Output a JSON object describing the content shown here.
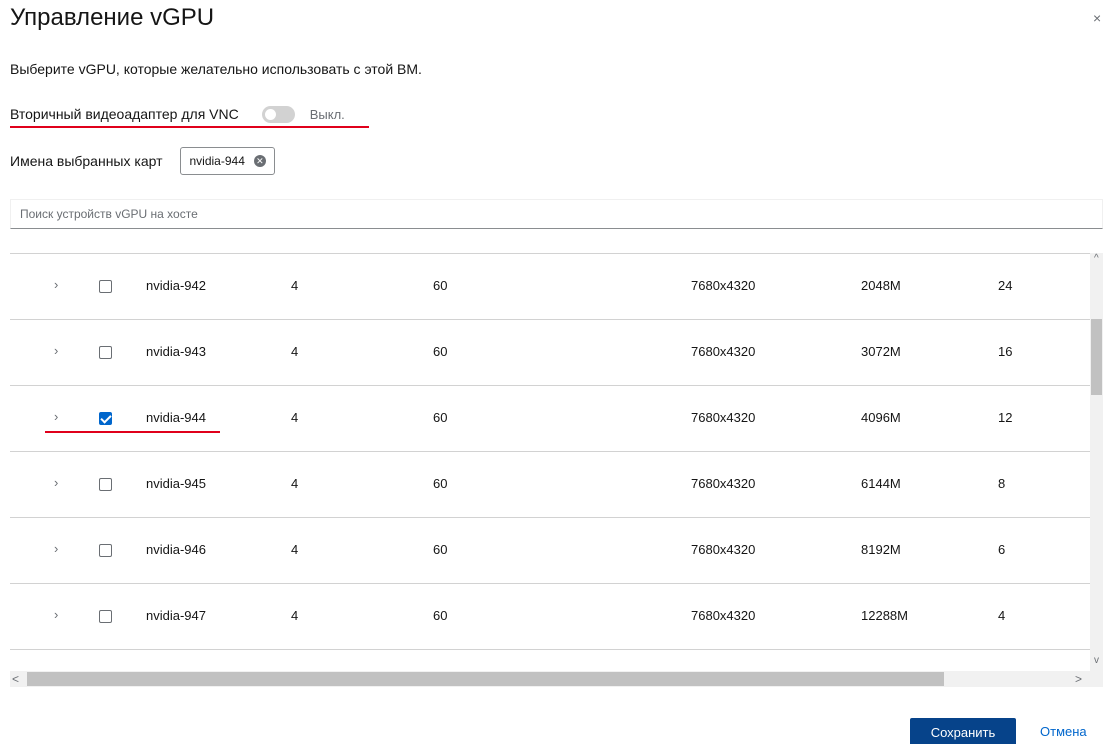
{
  "dialog": {
    "title": "Управление vGPU",
    "close_symbol": "×",
    "description": "Выберите vGPU, которые желательно использовать с этой ВМ."
  },
  "vnc": {
    "label": "Вторичный видеоадаптер для VNC",
    "toggle_state": "Выкл.",
    "enabled": false
  },
  "selected_cards": {
    "label": "Имена выбранных карт",
    "chips": [
      "nvidia-944"
    ],
    "remove_icon": "x-circle-icon"
  },
  "search": {
    "placeholder": "Поиск устройств vGPU на хосте",
    "value": ""
  },
  "table": {
    "rows": [
      {
        "name": "nvidia-942",
        "col_a": "4",
        "col_b": "60",
        "resolution": "7680x4320",
        "memory": "2048M",
        "max": "24",
        "checked": false
      },
      {
        "name": "nvidia-943",
        "col_a": "4",
        "col_b": "60",
        "resolution": "7680x4320",
        "memory": "3072M",
        "max": "16",
        "checked": false
      },
      {
        "name": "nvidia-944",
        "col_a": "4",
        "col_b": "60",
        "resolution": "7680x4320",
        "memory": "4096M",
        "max": "12",
        "checked": true
      },
      {
        "name": "nvidia-945",
        "col_a": "4",
        "col_b": "60",
        "resolution": "7680x4320",
        "memory": "6144M",
        "max": "8",
        "checked": false
      },
      {
        "name": "nvidia-946",
        "col_a": "4",
        "col_b": "60",
        "resolution": "7680x4320",
        "memory": "8192M",
        "max": "6",
        "checked": false
      },
      {
        "name": "nvidia-947",
        "col_a": "4",
        "col_b": "60",
        "resolution": "7680x4320",
        "memory": "12288M",
        "max": "4",
        "checked": false
      }
    ],
    "expand_icon": "chevron-right-icon"
  },
  "footer": {
    "save_label": "Сохранить",
    "cancel_label": "Отмена"
  },
  "colors": {
    "primary": "#06438a",
    "link": "#0066cc",
    "checkbox_checked": "#0066cc",
    "annotation_red": "#e0001b"
  }
}
